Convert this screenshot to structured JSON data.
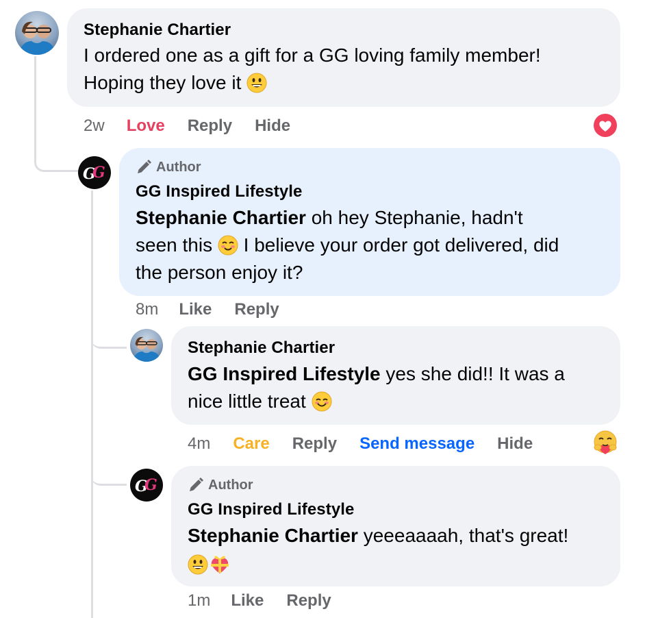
{
  "comments": [
    {
      "author": "Stephanie Chartier",
      "text_lines": [
        "I ordered one as a gift for a GG loving family member!",
        "Hoping they love it"
      ],
      "time": "2w",
      "reaction_label": "Love",
      "reaction_color": "#e4405f",
      "actions": [
        "Reply",
        "Hide"
      ],
      "badge_icon": "heart-reaction-icon"
    },
    {
      "author_badge": "Author",
      "author": "GG Inspired Lifestyle",
      "mention": "Stephanie Chartier",
      "text_parts": [
        " oh hey Stephanie, hadn't",
        "seen this",
        " I believe your order got delivered, did",
        "the person enjoy it?"
      ],
      "time": "8m",
      "actions": [
        "Like",
        "Reply"
      ]
    },
    {
      "author": "Stephanie Chartier",
      "mention": "GG Inspired Lifestyle",
      "text_parts": [
        " yes she did!! It was a",
        "nice little treat"
      ],
      "time": "4m",
      "reaction_label": "Care",
      "reaction_color": "#f7b125",
      "actions": [
        "Reply",
        "Send message",
        "Hide"
      ],
      "send_message_color": "#0866ff",
      "badge_icon": "care-reaction-icon"
    },
    {
      "author_badge": "Author",
      "author": "GG Inspired Lifestyle",
      "mention": "Stephanie Chartier",
      "text_parts": [
        " yeeeaaaah, that's great!"
      ],
      "time": "1m",
      "actions": [
        "Like",
        "Reply"
      ]
    }
  ],
  "brand_monogram": "GG"
}
